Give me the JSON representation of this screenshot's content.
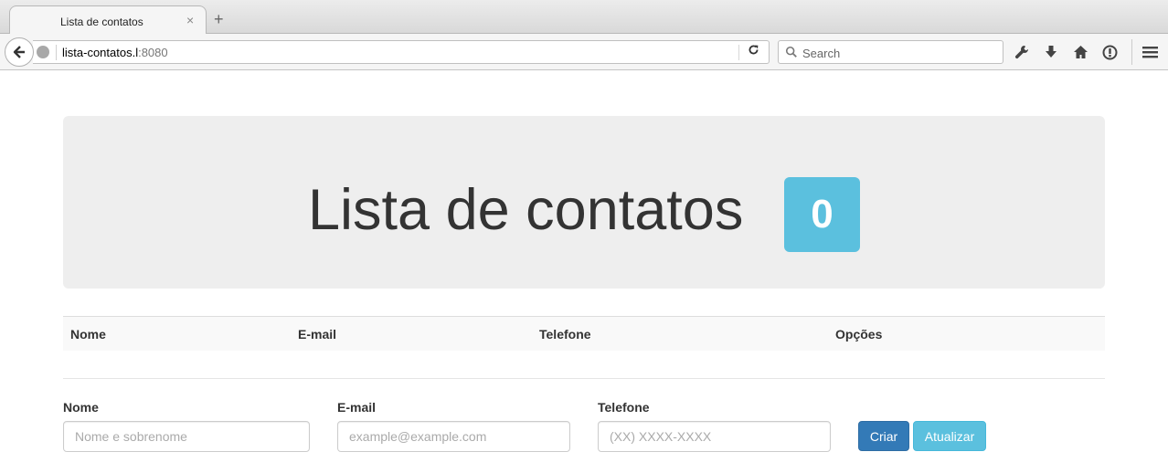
{
  "browser": {
    "tab_title": "Lista de contatos",
    "tab_close": "×",
    "new_tab": "+",
    "url_host": "lista-contatos.l",
    "url_port": ":8080",
    "search_placeholder": "Search",
    "icons": [
      "back-icon",
      "globe-icon",
      "reload-icon",
      "search-icon",
      "wrench-icon",
      "download-icon",
      "home-icon",
      "info-icon",
      "menu-icon"
    ]
  },
  "header": {
    "title": "Lista de contatos",
    "count": "0",
    "badge_color": "#5bc0de"
  },
  "table": {
    "columns": [
      "Nome",
      "E-mail",
      "Telefone",
      "Opções"
    ]
  },
  "form": {
    "name_label": "Nome",
    "name_placeholder": "Nome e sobrenome",
    "email_label": "E-mail",
    "email_placeholder": "example@example.com",
    "phone_label": "Telefone",
    "phone_placeholder": "(XX) XXXX-XXXX",
    "create_label": "Criar",
    "update_label": "Atualizar",
    "create_color": "#337ab7",
    "update_color": "#5bc0de"
  }
}
